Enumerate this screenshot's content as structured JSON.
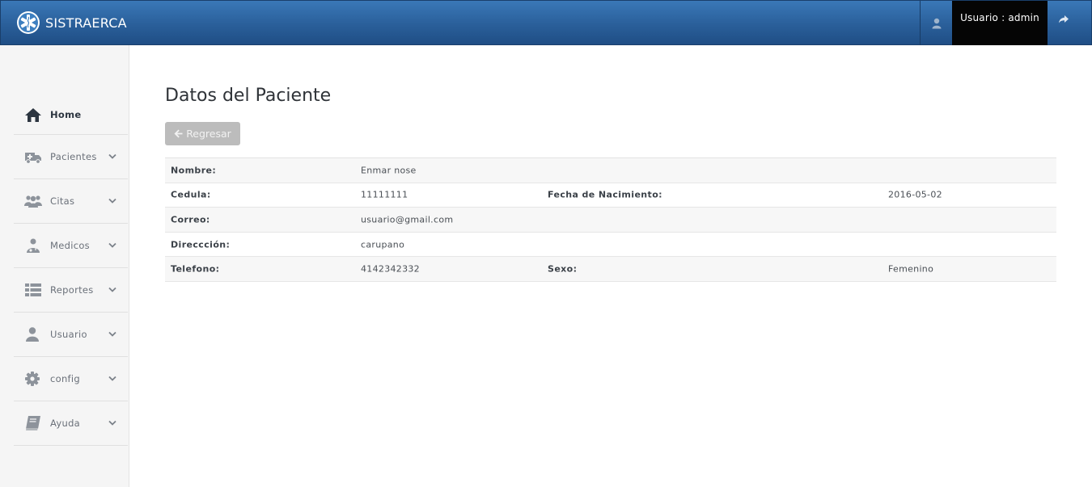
{
  "header": {
    "app_name": "SISTRAERCA",
    "user_label": "Usuario : admin"
  },
  "sidebar": {
    "items": [
      {
        "label": "Home",
        "icon": "home-icon"
      },
      {
        "label": "Pacientes",
        "icon": "ambulance-icon"
      },
      {
        "label": "Citas",
        "icon": "users-icon"
      },
      {
        "label": "Medicos",
        "icon": "doctor-icon"
      },
      {
        "label": "Reportes",
        "icon": "list-icon"
      },
      {
        "label": "Usuario",
        "icon": "user-icon"
      },
      {
        "label": "config",
        "icon": "gear-icon"
      },
      {
        "label": "Ayuda",
        "icon": "book-icon"
      }
    ]
  },
  "main": {
    "title": "Datos del Paciente",
    "back_button": "Regresar",
    "rows": [
      {
        "label": "Nombre:",
        "value": "Enmar nose",
        "label2": "",
        "value2": ""
      },
      {
        "label": "Cedula:",
        "value": "11111111",
        "label2": "Fecha de Nacimiento:",
        "value2": "2016-05-02"
      },
      {
        "label": "Correo:",
        "value": "usuario@gmail.com",
        "label2": "",
        "value2": ""
      },
      {
        "label": "Direccción:",
        "value": "carupano",
        "label2": "",
        "value2": ""
      },
      {
        "label": "Telefono:",
        "value": "4142342332",
        "label2": "Sexo:",
        "value2": "Femenino"
      }
    ]
  },
  "colors": {
    "topbar": "#2a5f9a",
    "user_box": "#050505",
    "sidebar_bg": "#f5f5f5",
    "button_disabled": "#bcbcbc"
  }
}
